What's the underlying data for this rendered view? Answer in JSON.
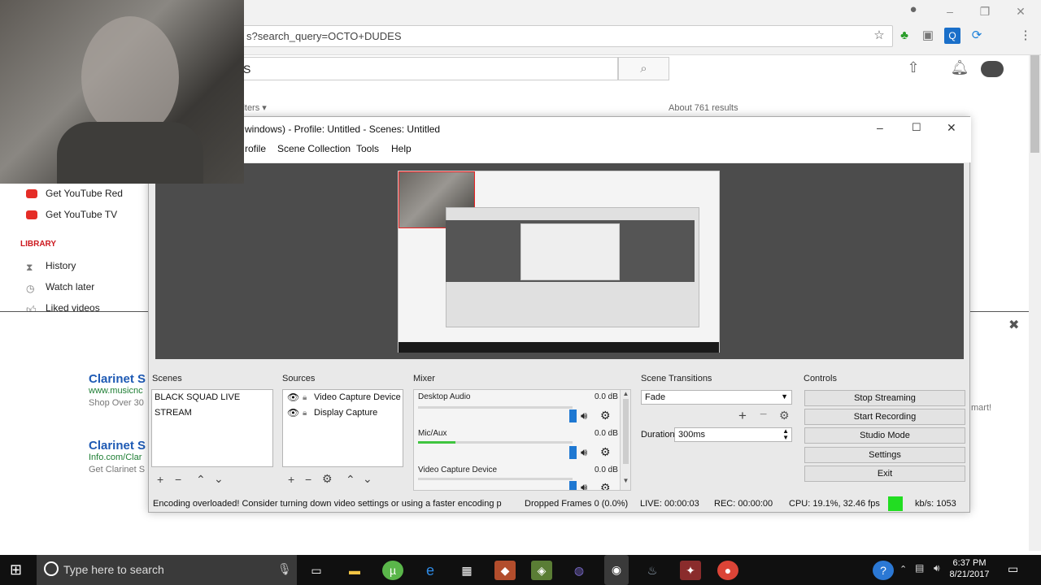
{
  "browser": {
    "address": "s?search_query=OCTO+DUDES",
    "search_text": "S",
    "results_count": "About 761 results",
    "filters_label": "ilters"
  },
  "youtube": {
    "sidebar": [
      {
        "label": "Get YouTube Red"
      },
      {
        "label": "Get YouTube TV"
      }
    ],
    "library_label": "LIBRARY",
    "library_items": [
      {
        "label": "History"
      },
      {
        "label": "Watch later"
      },
      {
        "label": "Liked videos"
      }
    ],
    "results": [
      {
        "title": "Clarinet S",
        "url": "www.musicnc",
        "desc": "Shop Over 30"
      },
      {
        "title": "Clarinet S",
        "url": "Info.com/Clar",
        "desc": "Get Clarinet S"
      }
    ],
    "right_snippet": "mart!"
  },
  "obs": {
    "title": "windows) - Profile: Untitled - Scenes: Untitled",
    "menu": [
      "rofile",
      "Scene Collection",
      "Tools",
      "Help"
    ],
    "docks": {
      "scenes": "Scenes",
      "sources": "Sources",
      "mixer": "Mixer",
      "transitions": "Scene Transitions",
      "controls": "Controls"
    },
    "scenes": [
      "BLACK SQUAD LIVE STREAM"
    ],
    "sources": [
      "Video Capture Device",
      "Display Capture"
    ],
    "mixer": [
      {
        "name": "Desktop Audio",
        "db": "0.0 dB",
        "level": 0
      },
      {
        "name": "Mic/Aux",
        "db": "0.0 dB",
        "level": 0.24
      },
      {
        "name": "Video Capture Device",
        "db": "0.0 dB",
        "level": 0
      }
    ],
    "transition": "Fade",
    "duration_label": "Duration",
    "duration_value": "300ms",
    "controls": [
      "Stop Streaming",
      "Start Recording",
      "Studio Mode",
      "Settings",
      "Exit"
    ],
    "status": {
      "message": "Encoding overloaded!  Consider turning down video settings or using a faster encoding p",
      "dropped": "Dropped Frames 0 (0.0%)",
      "live": "LIVE: 00:00:03",
      "rec": "REC: 00:00:00",
      "cpu": "CPU: 19.1%, 32.46 fps",
      "kbps": "kb/s: 1053",
      "indicator_color": "#22dd22"
    }
  },
  "taskbar": {
    "search_placeholder": "Type here to search",
    "time": "6:37 PM",
    "date": "8/21/2017"
  }
}
